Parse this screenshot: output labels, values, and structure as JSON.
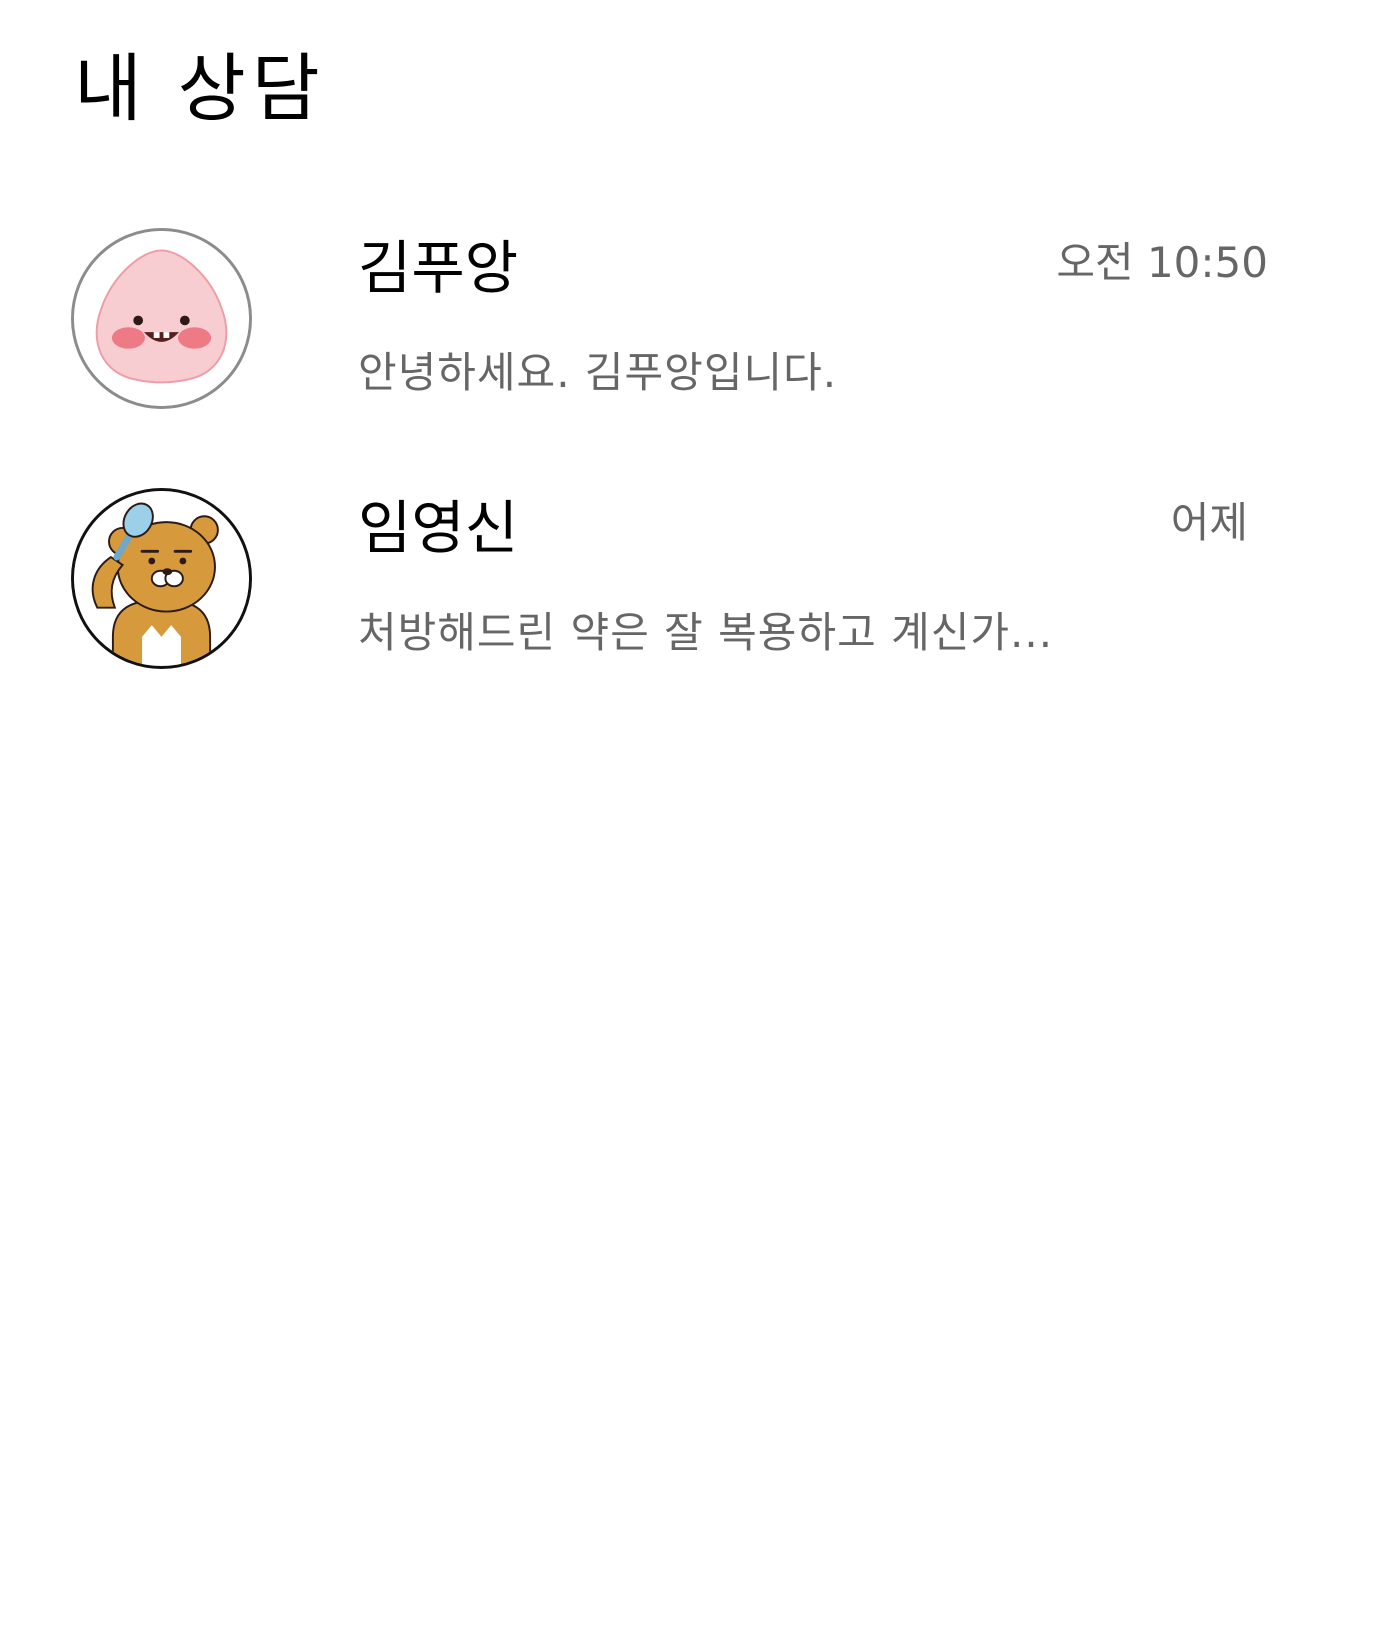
{
  "header": {
    "title": "내 상담"
  },
  "chats": [
    {
      "name": "김푸앙",
      "time": "오전 10:50",
      "preview": "안녕하세요. 김푸앙입니다.",
      "avatar_icon": "peach-character-icon"
    },
    {
      "name": "임영신",
      "time": "어제",
      "preview": "처방해드린 약은 잘 복용하고 계신가...",
      "avatar_icon": "lion-character-icon"
    }
  ],
  "colors": {
    "background": "#ffffff",
    "title_text": "#000000",
    "secondary_text": "#666666",
    "peach": "#f5c6cc",
    "lion": "#d69a3c"
  }
}
